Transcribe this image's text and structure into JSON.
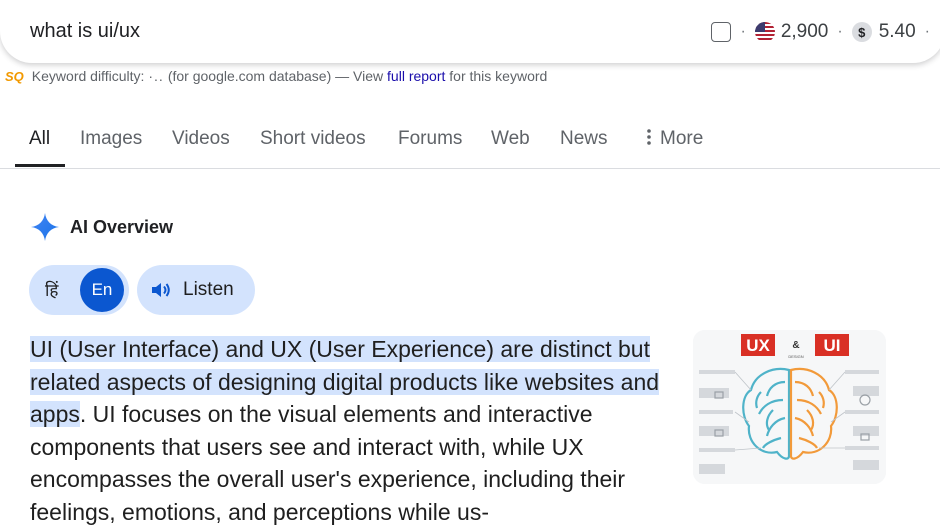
{
  "search": {
    "query": "what is ui/ux"
  },
  "metrics": {
    "volume": "2,900",
    "cpc": "5.40",
    "separator": "·",
    "dollar_symbol": "$"
  },
  "keyword_difficulty": {
    "label": "Keyword difficulty:",
    "dots": "·..",
    "db_text": "(for google.com database) — View",
    "link": "full report",
    "suffix": "for this keyword",
    "logo": "SQ"
  },
  "tabs": [
    "All",
    "Images",
    "Videos",
    "Short videos",
    "Forums",
    "Web",
    "News",
    "More"
  ],
  "more_icon": "vertical-dots-icon",
  "ai_overview": {
    "title": "AI Overview",
    "lang_hi": "हिं",
    "lang_en": "En",
    "listen_label": "Listen",
    "highlight": "UI (User Interface) and UX (User Experience) are distinct but related aspects of designing digital products like websites and apps",
    "body": ". UI focuses on the visual elements and interactive components that users see and interact with, while UX encompasses the overall user's experience, in­cluding their feelings, emotions, and perceptions while us-",
    "image_labels": {
      "ux": "UX",
      "amp": "&",
      "ui": "UI",
      "design": "DESIGN"
    }
  },
  "colors": {
    "accent": "#0b57d0",
    "chip_bg": "#d3e3fd",
    "brain_left": "#4fb3c9",
    "brain_right": "#f29a3a",
    "label_red": "#d93025"
  }
}
